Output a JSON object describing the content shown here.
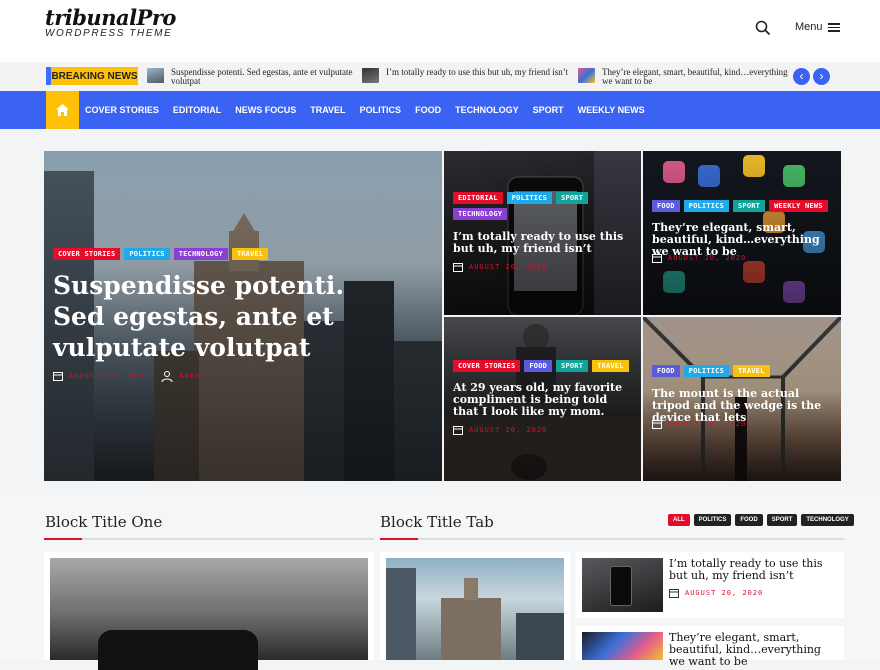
{
  "brand": {
    "title": "tribunalPro",
    "subtitle": "WORDPRESS THEME"
  },
  "header": {
    "menu_label": "Menu",
    "search_icon": "search-icon",
    "menu_icon": "hamburger-icon"
  },
  "ticker": {
    "label": "BREAKING NEWS",
    "items": [
      {
        "text": "Suspendisse potenti. Sed egestas, ante et vulputate volutpat"
      },
      {
        "text": "I’m totally ready to use this but uh, my friend isn’t"
      },
      {
        "text": "They’re elegant, smart, beautiful, kind…everything we want to be"
      }
    ]
  },
  "nav": {
    "home_icon": "home-icon",
    "items": [
      "COVER STORIES",
      "EDITORIAL",
      "NEWS FOCUS",
      "TRAVEL",
      "POLITICS",
      "FOOD",
      "TECHNOLOGY",
      "SPORT",
      "WEEKLY NEWS"
    ]
  },
  "featured": {
    "main": {
      "tags": [
        "COVER STORIES",
        "POLITICS",
        "TECHNOLOGY",
        "TRAVEL"
      ],
      "title": "Suspendisse potenti. Sed egestas, ante et vulputate volutpat",
      "date": "AUGUST 20, 2020",
      "author": "Admin"
    },
    "c1": {
      "tags": [
        "EDITORIAL",
        "POLITICS",
        "SPORT",
        "TECHNOLOGY"
      ],
      "title": "I’m totally ready to use this but uh, my friend isn’t",
      "date": "AUGUST 20, 2020"
    },
    "c2": {
      "tags": [
        "FOOD",
        "POLITICS",
        "SPORT",
        "WEEKLY NEWS"
      ],
      "title": "They’re elegant, smart, beautiful, kind…everything we want to be",
      "date": "AUGUST 20, 2020"
    },
    "c3": {
      "tags": [
        "COVER STORIES",
        "FOOD",
        "SPORT",
        "TRAVEL"
      ],
      "title": "At 29 years old, my favorite compliment is being told that I look like my mom.",
      "date": "AUGUST 20, 2020"
    },
    "c4": {
      "tags": [
        "FOOD",
        "POLITICS",
        "TRAVEL"
      ],
      "title": "The mount is the actual tripod and the wedge is the device that lets",
      "date": "AUGUST 20, 2020"
    }
  },
  "blocks": {
    "one_title": "Block Title One",
    "tab_title": "Block Title Tab",
    "tabs": [
      "ALL",
      "POLITICS",
      "FOOD",
      "SPORT",
      "TECHNOLOGY"
    ],
    "side": [
      {
        "title": "I’m totally ready to use this but uh, my friend isn’t",
        "date": "AUGUST 20, 2020"
      },
      {
        "title": "They’re elegant, smart, beautiful, kind…everything we want to be"
      }
    ]
  },
  "colors": {
    "accent": "#3b63f3",
    "highlight": "#ffc107",
    "red": "#e30c2a"
  }
}
